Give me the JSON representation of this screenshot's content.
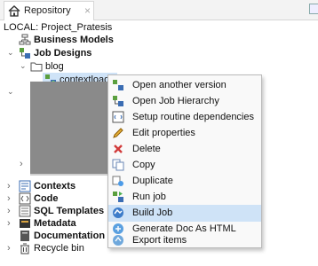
{
  "tab": {
    "label": "Repository"
  },
  "root_label": "LOCAL: Project_Pratesis",
  "tree": {
    "business_models": "Business Models",
    "job_designs": "Job Designs",
    "blog": "blog",
    "contextload": "contextload 0.1",
    "contexts": "Contexts",
    "code": "Code",
    "sql_templates": "SQL Templates",
    "metadata": "Metadata",
    "documentation": "Documentation",
    "recycle_bin": "Recycle bin"
  },
  "context_menu": {
    "items": [
      {
        "label": "Open another version",
        "icon": "job-icon"
      },
      {
        "label": "Open Job Hierarchy",
        "icon": "hierarchy-icon"
      },
      {
        "label": "Setup routine dependencies",
        "icon": "dependencies-icon"
      },
      {
        "label": "Edit properties",
        "icon": "pencil-icon"
      },
      {
        "label": "Delete",
        "icon": "delete-x-icon"
      },
      {
        "label": "Copy",
        "icon": "copy-icon"
      },
      {
        "label": "Duplicate",
        "icon": "duplicate-icon"
      },
      {
        "label": "Run job",
        "icon": "run-job-icon"
      },
      {
        "label": "Build Job",
        "icon": "build-job-icon"
      },
      {
        "label": "Generate Doc As HTML",
        "icon": "generate-doc-icon"
      },
      {
        "label": "Export items",
        "icon": "export-icon"
      }
    ],
    "highlighted_index": 8
  },
  "colors": {
    "selection": "#cfe3f7",
    "accent_green": "#4caf50"
  }
}
